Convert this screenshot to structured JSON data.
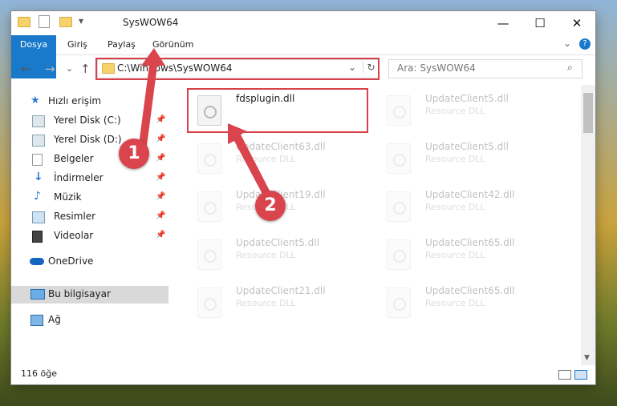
{
  "window": {
    "title": "SysWOW64",
    "min_icon": "—",
    "max_icon": "☐",
    "close_icon": "✕",
    "help_icon": "?",
    "collapse_icon": "⌄"
  },
  "ribbon": {
    "tabs": [
      "Dosya",
      "Giriş",
      "Paylaş",
      "Görünüm"
    ]
  },
  "address": {
    "path": "C:\\Windows\\SysWOW64",
    "refresh_icon": "↻",
    "dropdown_icon": "⌄"
  },
  "search": {
    "placeholder": "Ara: SysWOW64",
    "icon": "⌕"
  },
  "nav_buttons": {
    "back": "←",
    "forward": "→",
    "recent": "⌄",
    "up": "↑"
  },
  "sidebar": {
    "items": [
      {
        "label": "Hızlı erişim",
        "icon": "star-icon"
      },
      {
        "label": "Yerel Disk (C:)",
        "icon": "drive-icon",
        "pinned": true
      },
      {
        "label": "Yerel Disk (D:)",
        "icon": "drive-icon",
        "pinned": true
      },
      {
        "label": "Belgeler",
        "icon": "documents-icon",
        "pinned": true
      },
      {
        "label": "İndirmeler",
        "icon": "download-icon",
        "pinned": true
      },
      {
        "label": "Müzik",
        "icon": "music-icon",
        "pinned": true
      },
      {
        "label": "Resimler",
        "icon": "pictures-icon",
        "pinned": true
      },
      {
        "label": "Videolar",
        "icon": "videos-icon",
        "pinned": true
      },
      {
        "label": "OneDrive",
        "icon": "cloud-icon"
      },
      {
        "label": "Bu bilgisayar",
        "icon": "computer-icon",
        "selected": true
      },
      {
        "label": "Ağ",
        "icon": "network-icon"
      }
    ],
    "pin_glyph": "📌"
  },
  "files": [
    {
      "name": "fdsplugin.dll",
      "type": ""
    },
    {
      "name": "UpdateClient5.dll",
      "type": "Resource DLL"
    },
    {
      "name": "UpdateClient63.dll",
      "type": "Resource DLL"
    },
    {
      "name": "UpdateClient5.dll",
      "type": "Resource DLL"
    },
    {
      "name": "UpdateClient19.dll",
      "type": "Resource DLL"
    },
    {
      "name": "UpdateClient42.dll",
      "type": "Resource DLL"
    },
    {
      "name": "UpdateClient5.dll",
      "type": "Resource DLL"
    },
    {
      "name": "UpdateClient65.dll",
      "type": "Resource DLL"
    },
    {
      "name": "UpdateClient21.dll",
      "type": "Resource DLL"
    },
    {
      "name": "UpdateClient65.dll",
      "type": "Resource DLL"
    }
  ],
  "status": {
    "item_count": "116 öğe"
  },
  "annotations": {
    "badge1": "1",
    "badge2": "2",
    "accent": "#d9444d"
  }
}
